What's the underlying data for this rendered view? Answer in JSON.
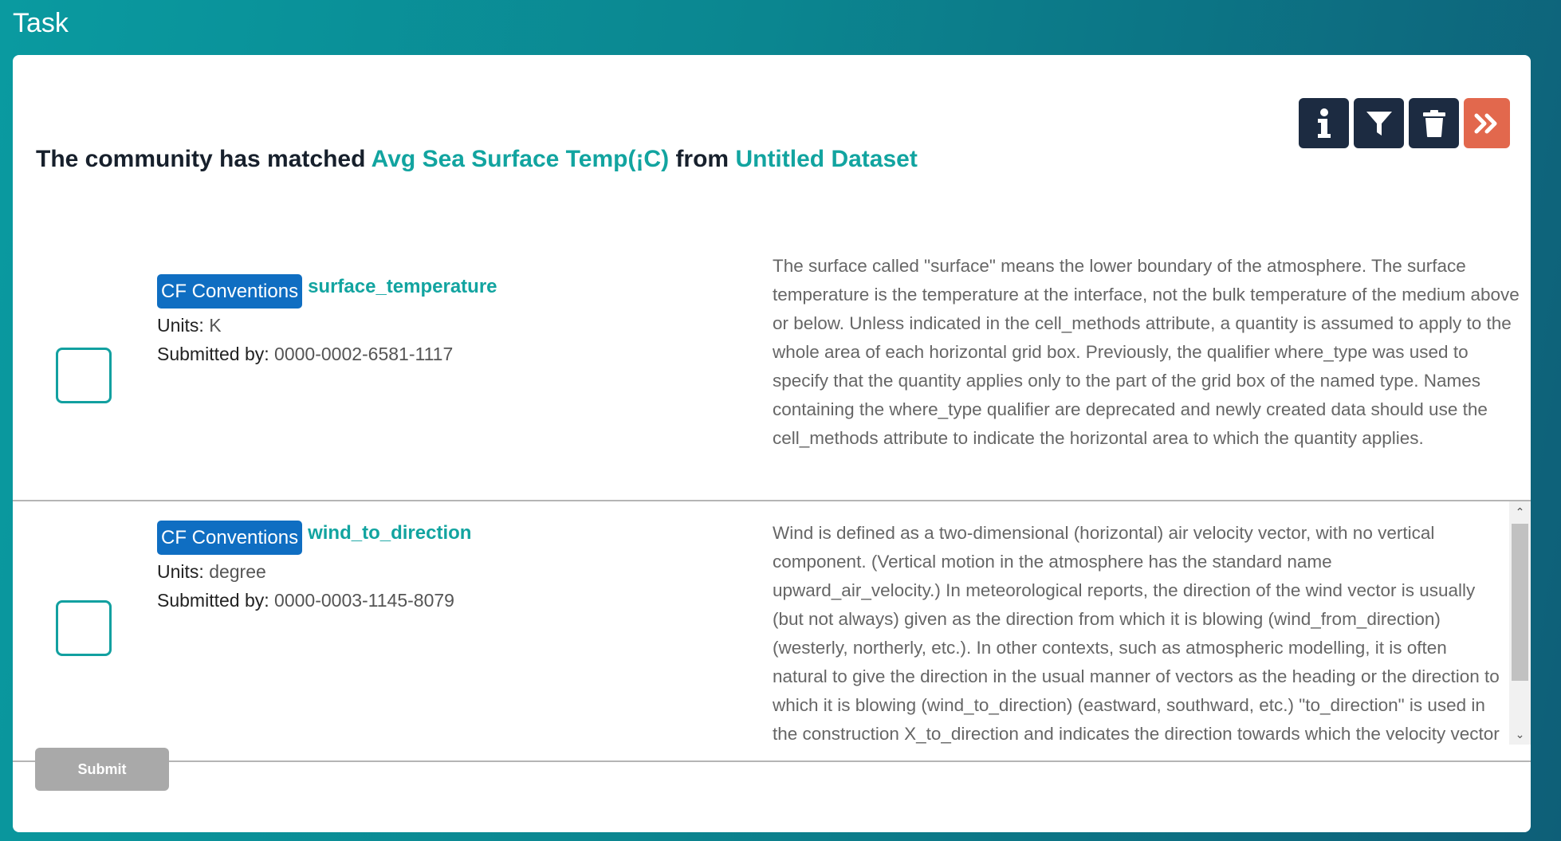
{
  "window": {
    "title": "Task"
  },
  "toolbar": {
    "buttons": [
      {
        "icon": "info-icon"
      },
      {
        "icon": "filter-icon"
      },
      {
        "icon": "trash-icon"
      },
      {
        "icon": "double-chevron-right-icon"
      }
    ]
  },
  "heading": {
    "prefix": "The community has matched",
    "variable": "Avg Sea Surface Temp(¡C)",
    "connector": "from",
    "dataset": "Untitled Dataset"
  },
  "matches": [
    {
      "badge": "CF Conventions",
      "term": "surface_temperature",
      "units_label": "Units:",
      "units": "K",
      "submitted_label": "Submitted by:",
      "submitted_by": "0000-0002-6581-1117",
      "checked": false,
      "description": "The surface called \"surface\" means the lower boundary of the atmosphere. The surface temperature is the temperature at the interface, not the bulk temperature of the medium above or below. Unless indicated in the cell_methods attribute, a quantity is assumed to apply to the whole area of each horizontal grid box. Previously, the qualifier where_type was used to specify that the quantity applies only to the part of the grid box of the named type. Names containing the where_type qualifier are deprecated and newly created data should use the cell_methods attribute to indicate the horizontal area to which the quantity applies."
    },
    {
      "badge": "CF Conventions",
      "term": "wind_to_direction",
      "units_label": "Units:",
      "units": "degree",
      "submitted_label": "Submitted by:",
      "submitted_by": "0000-0003-1145-8079",
      "checked": false,
      "description": "Wind is defined as a two-dimensional (horizontal) air velocity vector, with no vertical component. (Vertical motion in the atmosphere has the standard name upward_air_velocity.) In meteorological reports, the direction of the wind vector is usually (but not always) given as the direction from which it is blowing (wind_from_direction) (westerly, northerly, etc.). In other contexts, such as atmospheric modelling, it is often natural to give the direction in the usual manner of vectors as the heading or the direction to which it is blowing (wind_to_direction) (eastward, southward, etc.) \"to_direction\" is used in the construction X_to_direction and indicates the direction towards which the velocity vector of X is headed. The direction is"
    }
  ],
  "submit": {
    "label": "Submit",
    "enabled": false
  },
  "colors": {
    "accent": "#12a4a0",
    "badge": "#0f6ec2",
    "toolbar_dark": "#1c2b41",
    "toolbar_accent": "#e2684d",
    "submit_disabled": "#a9a9a9"
  }
}
